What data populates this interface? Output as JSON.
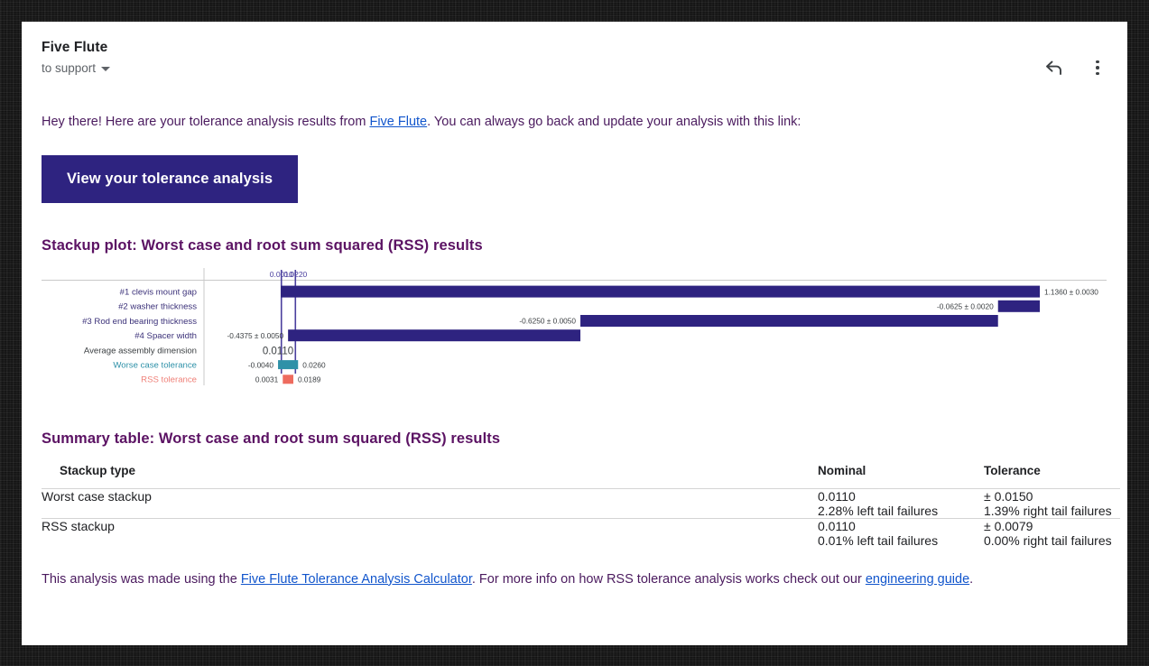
{
  "email": {
    "sender": "Five Flute",
    "recipient": "to support",
    "reply_icon": "reply-arrow-icon",
    "more_icon": "kebab-menu-icon"
  },
  "intro": {
    "part1": "Hey there! Here are your tolerance analysis results from ",
    "link": "Five Flute",
    "part2": ". You can always go back and update your analysis with this link:"
  },
  "cta": {
    "label": "View your tolerance analysis"
  },
  "plot": {
    "title": "Stackup plot: Worst case and root sum squared (RSS) results"
  },
  "chart_data": {
    "type": "bar",
    "title": "Stackup plot: Worst case and root sum squared (RSS) results",
    "orientation": "horizontal-waterfall",
    "xlabel": "",
    "ylabel": "",
    "axis_ticks": [
      "0.0010",
      "0.0220"
    ],
    "axis_tick_values": [
      0.001,
      0.022
    ],
    "categories": [
      "#1 clevis mount gap",
      "#2 washer thickness",
      "#3 Rod end bearing thickness",
      "#4 Spacer width",
      "Average assembly dimension",
      "Worse case tolerance",
      "RSS tolerance"
    ],
    "rows": [
      {
        "label": "#1 clevis mount gap",
        "value_label": "1.1360 ± 0.0030",
        "nominal": 1.136,
        "tol": 0.003,
        "start": 0.0,
        "end": 1.136,
        "color": "#2e2380",
        "label_color": "#3b3179",
        "label_side": "right"
      },
      {
        "label": "#2 washer thickness",
        "value_label": "-0.0625 ± 0.0020",
        "nominal": -0.0625,
        "tol": 0.002,
        "start": 1.136,
        "end": 1.0735,
        "color": "#2e2380",
        "label_color": "#3b3179",
        "label_side": "left"
      },
      {
        "label": "#3 Rod end bearing thickness",
        "value_label": "-0.6250 ± 0.0050",
        "nominal": -0.625,
        "tol": 0.005,
        "start": 1.0735,
        "end": 0.4485,
        "color": "#2e2380",
        "label_color": "#3b3179",
        "label_side": "left"
      },
      {
        "label": "#4 Spacer width",
        "value_label": "-0.4375 ± 0.0050",
        "nominal": -0.4375,
        "tol": 0.005,
        "start": 0.4485,
        "end": 0.011,
        "color": "#2e2380",
        "label_color": "#3b3179",
        "label_side": "left"
      },
      {
        "label": "Average assembly dimension",
        "value_label": "0.0110",
        "nominal": 0.011,
        "tol": 0.0,
        "start": 0.011,
        "end": 0.011,
        "color": "#444444",
        "label_color": "#3c4043",
        "label_side": "center"
      },
      {
        "label": "Worse case tolerance",
        "value_label_low": "-0.0040",
        "value_label_high": "0.0260",
        "low": -0.004,
        "high": 0.026,
        "color": "#2e91a8",
        "label_color": "#2e91a8",
        "label_side": "both"
      },
      {
        "label": "RSS tolerance",
        "value_label_low": "0.0031",
        "value_label_high": "0.0189",
        "low": 0.0031,
        "high": 0.0189,
        "color": "#ee6b5e",
        "label_color": "#ef8179",
        "label_side": "both"
      }
    ],
    "reference_lines": [
      {
        "label": "0.0010",
        "value": 0.001,
        "color": "#4a3f9e"
      },
      {
        "label": "0.0220",
        "value": 0.022,
        "color": "#4a3f9e"
      }
    ]
  },
  "summary": {
    "title": "Summary table: Worst case and root sum squared (RSS) results",
    "headers": [
      "Stackup type",
      "Nominal",
      "Tolerance"
    ],
    "rows": [
      {
        "type": "Worst case stackup",
        "nominal": "0.0110",
        "tolerance": "± 0.0150",
        "left_tail": "2.28% left tail failures",
        "right_tail": "1.39% right tail failures"
      },
      {
        "type": "RSS stackup",
        "nominal": "0.0110",
        "tolerance": "± 0.0079",
        "left_tail": "0.01% left tail failures",
        "right_tail": "0.00% right tail failures"
      }
    ]
  },
  "footer": {
    "part1": "This analysis was made using the ",
    "link1": "Five Flute Tolerance Analysis Calculator",
    "part2": ". For more info on how RSS tolerance analysis works check out our ",
    "link2": "engineering guide",
    "part3": "."
  },
  "colors": {
    "brand_purple": "#2e2380",
    "heading_purple": "#5b1263",
    "body_purple": "#4a1a5e",
    "link_blue": "#1155cc",
    "teal": "#2e91a8",
    "salmon": "#ee6b5e"
  }
}
